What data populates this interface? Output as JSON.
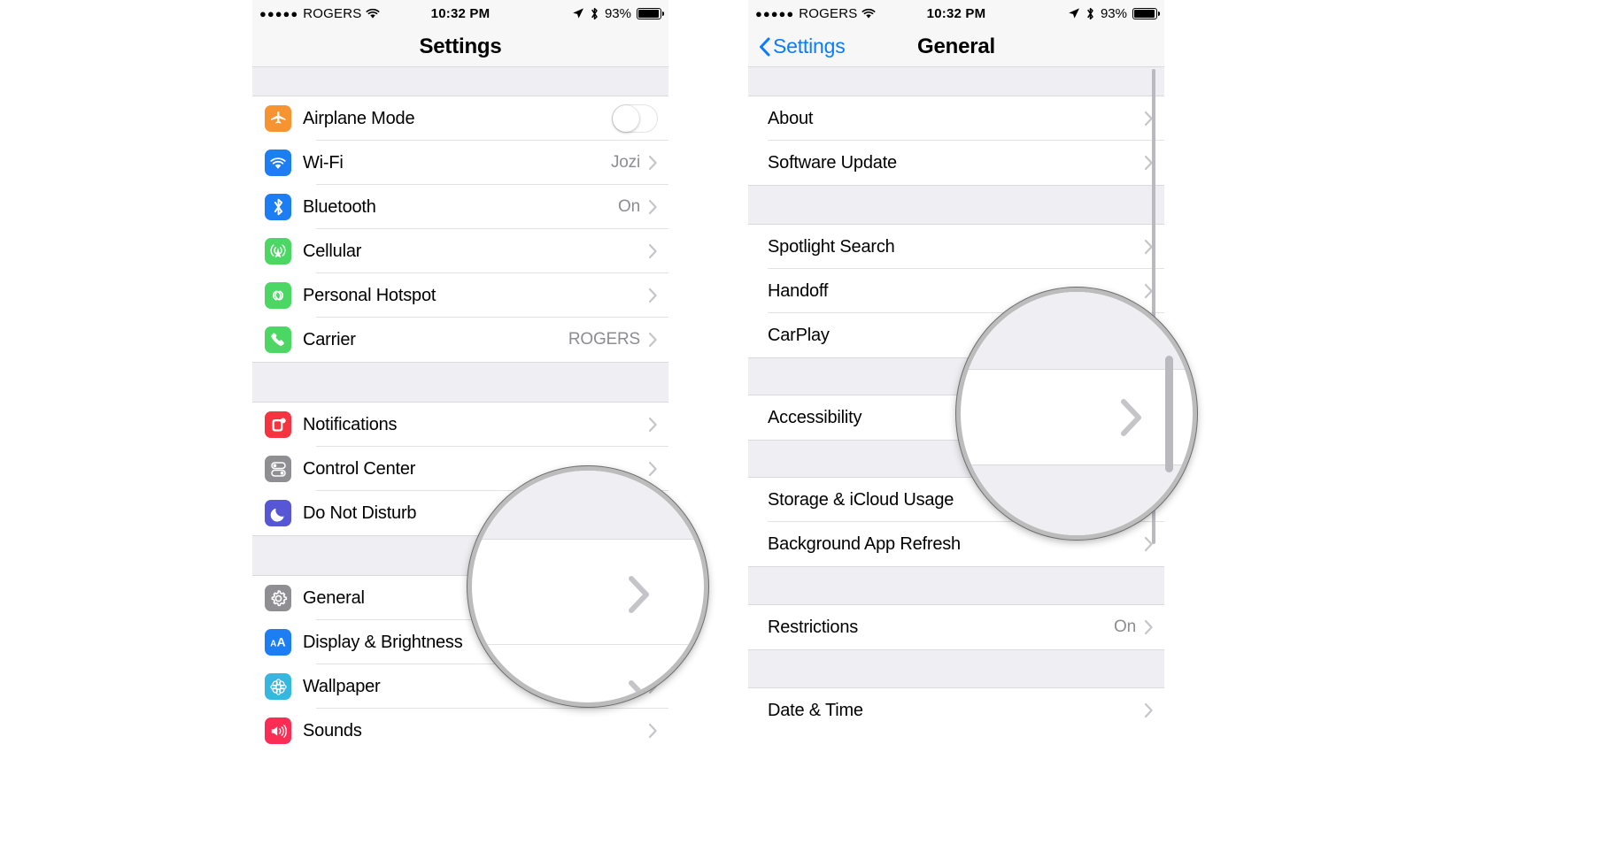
{
  "colors": {
    "accent_blue": "#0b7cfb",
    "group_bg": "#eeeef3",
    "separator": "#e2e2e5",
    "value_gray": "#8c8c91",
    "chevron_gray": "#c4c4c9",
    "orange": "#f79431",
    "blue": "#1d7ef4",
    "green": "#4cd663",
    "red": "#f5343f",
    "gray": "#8e8e93",
    "purple": "#5757d6",
    "teal": "#35b8e0",
    "pink": "#fb2d55"
  },
  "status_bar": {
    "signal_dots": "●●●●●",
    "carrier": "ROGERS",
    "wifi_icon": "wifi-icon",
    "time": "10:32 PM",
    "location_icon": "location-arrow-icon",
    "bluetooth_icon": "bluetooth-icon",
    "battery_percent": "93%",
    "battery_level": 93
  },
  "left_phone": {
    "nav": {
      "title": "Settings"
    },
    "groups": [
      {
        "gap_height": 34,
        "rows": [
          {
            "label": "Airplane Mode",
            "icon": "airplane-icon",
            "icon_color": "#f79431",
            "control": "toggle",
            "toggle_on": false
          },
          {
            "label": "Wi-Fi",
            "icon": "wifi-icon",
            "icon_color": "#1d7ef4",
            "value": "Jozi",
            "control": "chevron"
          },
          {
            "label": "Bluetooth",
            "icon": "bluetooth-icon",
            "icon_color": "#1d7ef4",
            "value": "On",
            "control": "chevron"
          },
          {
            "label": "Cellular",
            "icon": "cellular-antenna-icon",
            "icon_color": "#4cd663",
            "value": "",
            "control": "chevron"
          },
          {
            "label": "Personal Hotspot",
            "icon": "hotspot-link-icon",
            "icon_color": "#4cd663",
            "value": "",
            "control": "chevron"
          },
          {
            "label": "Carrier",
            "icon": "phone-icon",
            "icon_color": "#4cd663",
            "value": "ROGERS",
            "control": "chevron"
          }
        ]
      },
      {
        "gap_height": 46,
        "rows": [
          {
            "label": "Notifications",
            "icon": "notifications-icon",
            "icon_color": "#f5343f",
            "value": "",
            "control": "chevron"
          },
          {
            "label": "Control Center",
            "icon": "control-center-icon",
            "icon_color": "#8e8e93",
            "value": "",
            "control": "chevron"
          },
          {
            "label": "Do Not Disturb",
            "icon": "moon-icon",
            "icon_color": "#5757d6",
            "value": "",
            "control": "chevron"
          }
        ]
      },
      {
        "gap_height": 46,
        "rows": [
          {
            "label": "General",
            "icon": "gear-icon",
            "icon_color": "#8e8e93",
            "value": "",
            "control": "chevron"
          },
          {
            "label": "Display & Brightness",
            "icon": "text-size-icon",
            "icon_color": "#1d7ef4",
            "value": "",
            "control": "chevron"
          },
          {
            "label": "Wallpaper",
            "icon": "wallpaper-flower-icon",
            "icon_color": "#35b8e0",
            "value": "",
            "control": "chevron"
          },
          {
            "label": "Sounds",
            "icon": "speaker-icon",
            "icon_color": "#fb2d55",
            "value": "",
            "control": "chevron"
          }
        ]
      }
    ]
  },
  "right_phone": {
    "nav": {
      "back_label": "Settings",
      "back_icon": "chevron-left-icon",
      "title": "General"
    },
    "groups": [
      {
        "gap_height": 34,
        "rows": [
          {
            "label": "About",
            "value": "",
            "control": "chevron"
          },
          {
            "label": "Software Update",
            "value": "",
            "control": "chevron"
          }
        ]
      },
      {
        "gap_height": 45,
        "rows": [
          {
            "label": "Spotlight Search",
            "value": "",
            "control": "chevron"
          },
          {
            "label": "Handoff",
            "value": "",
            "control": "chevron"
          },
          {
            "label": "CarPlay",
            "value": "",
            "control": "chevron"
          }
        ]
      },
      {
        "gap_height": 43,
        "rows": [
          {
            "label": "Accessibility",
            "value": "",
            "control": "chevron"
          }
        ]
      },
      {
        "gap_height": 43,
        "rows": [
          {
            "label": "Storage & iCloud Usage",
            "value": "",
            "control": "chevron"
          },
          {
            "label": "Background App Refresh",
            "value": "",
            "control": "chevron"
          }
        ]
      },
      {
        "gap_height": 44,
        "rows": [
          {
            "label": "Restrictions",
            "value": "On",
            "control": "chevron"
          }
        ]
      },
      {
        "gap_height": 44,
        "rows": [
          {
            "label": "Date & Time",
            "value": "",
            "control": "chevron"
          }
        ]
      }
    ]
  },
  "loupes": [
    {
      "name": "magnifier-left",
      "target": "general-row-chevron"
    },
    {
      "name": "magnifier-right",
      "target": "accessibility-row-chevron"
    }
  ]
}
